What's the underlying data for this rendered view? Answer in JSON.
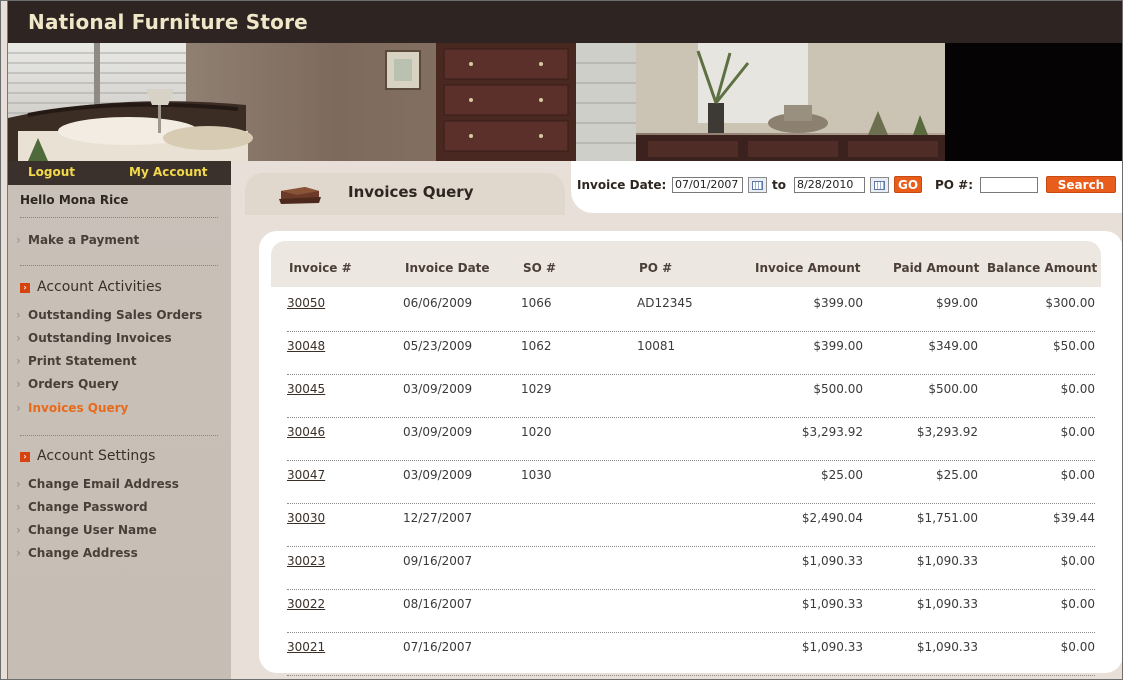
{
  "site": {
    "title": "National Furniture Store"
  },
  "header": {
    "logout_label": "Logout",
    "my_account_label": "My Account"
  },
  "user": {
    "greeting": "Hello Mona Rice"
  },
  "sidebar": {
    "make_payment": "Make a Payment",
    "account_activities": {
      "heading": "Account Activities",
      "items": [
        {
          "label": "Outstanding Sales Orders",
          "active": false
        },
        {
          "label": "Outstanding Invoices",
          "active": false
        },
        {
          "label": "Print Statement",
          "active": false
        },
        {
          "label": "Orders Query",
          "active": false
        },
        {
          "label": "Invoices Query",
          "active": true
        }
      ]
    },
    "account_settings": {
      "heading": "Account Settings",
      "items": [
        {
          "label": "Change Email Address"
        },
        {
          "label": "Change Password"
        },
        {
          "label": "Change User Name"
        },
        {
          "label": "Change Address"
        }
      ]
    }
  },
  "page": {
    "title": "Invoices Query"
  },
  "filter": {
    "invoice_date_label": "Invoice Date:",
    "from_date": "07/01/2007",
    "to_label": "to",
    "to_date": "8/28/2010",
    "go_label": "GO",
    "po_label": "PO #:",
    "po_value": "",
    "search_label": "Search"
  },
  "table": {
    "columns": [
      "Invoice #",
      "Invoice Date",
      "SO #",
      "PO #",
      "Invoice Amount",
      "Paid Amount",
      "Balance Amount"
    ],
    "rows": [
      [
        "30050",
        "06/06/2009",
        "1066",
        "AD12345",
        "$399.00",
        "$99.00",
        "$300.00"
      ],
      [
        "30048",
        "05/23/2009",
        "1062",
        "10081",
        "$399.00",
        "$349.00",
        "$50.00"
      ],
      [
        "30045",
        "03/09/2009",
        "1029",
        "",
        "$500.00",
        "$500.00",
        "$0.00"
      ],
      [
        "30046",
        "03/09/2009",
        "1020",
        "",
        "$3,293.92",
        "$3,293.92",
        "$0.00"
      ],
      [
        "30047",
        "03/09/2009",
        "1030",
        "",
        "$25.00",
        "$25.00",
        "$0.00"
      ],
      [
        "30030",
        "12/27/2007",
        "",
        "",
        "$2,490.04",
        "$1,751.00",
        "$39.44"
      ],
      [
        "30023",
        "09/16/2007",
        "",
        "",
        "$1,090.33",
        "$1,090.33",
        "$0.00"
      ],
      [
        "30022",
        "08/16/2007",
        "",
        "",
        "$1,090.33",
        "$1,090.33",
        "$0.00"
      ],
      [
        "30021",
        "07/16/2007",
        "",
        "",
        "$1,090.33",
        "$1,090.33",
        "$0.00"
      ]
    ]
  },
  "colors": {
    "accent_orange": "#e85c1c",
    "header_dark": "#2e2421",
    "sidebar_bg": "#c9c1b8",
    "link_yellow": "#f2d84a"
  }
}
